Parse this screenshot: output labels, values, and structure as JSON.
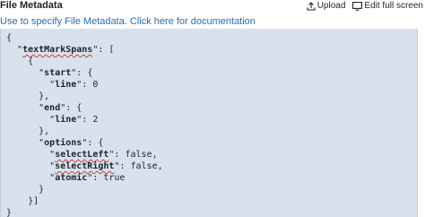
{
  "header": {
    "title": "File Metadata",
    "upload_label": "Upload",
    "edit_full_label": "Edit full screen"
  },
  "hint": {
    "text": "Use to specify File Metadata.",
    "link": "Click here for documentation"
  },
  "editor": {
    "punct": {
      "l1": "{",
      "l2_pre": "  \"",
      "l2_post": "\": [",
      "l3": "    {",
      "l4_pre": "      \"",
      "l4_post": "\": {",
      "l5_pre": "        \"",
      "l5_post": "\": 0",
      "l6": "      },",
      "l7_pre": "      \"",
      "l7_post": "\": {",
      "l8_pre": "        \"",
      "l8_post": "\": 2",
      "l9": "      },",
      "l10_pre": "      \"",
      "l10_post": "\": {",
      "l11_pre": "        \"",
      "l11_post": "\": false,",
      "l12_pre": "        \"",
      "l12_post": "\": false,",
      "l13_pre": "        \"",
      "l13_post": "\": true",
      "l14": "      }",
      "l15": "    }]",
      "l16": "}"
    },
    "keys": {
      "textMarkSpans": "textMarkSpans",
      "start": "start",
      "start_line": "line",
      "end": "end",
      "end_line": "line",
      "options": "options",
      "selectLeft": "selectLeft",
      "selectRight": "selectRight",
      "atomic": "atomic"
    }
  },
  "icons": {
    "upload": "upload-icon",
    "edit_full": "edit-fullscreen-icon"
  }
}
